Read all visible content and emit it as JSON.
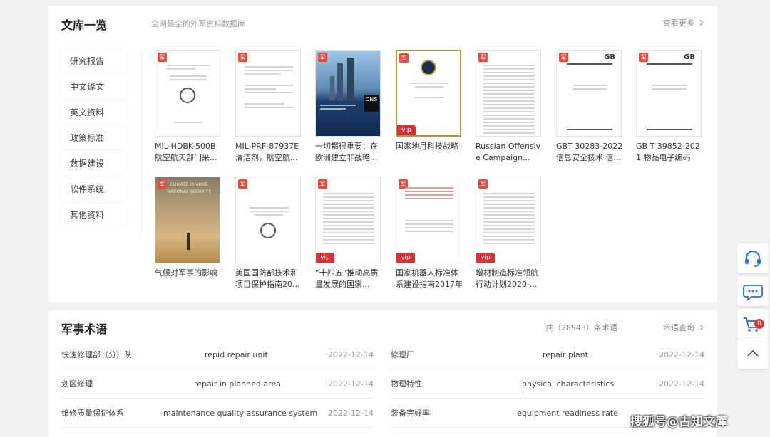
{
  "library": {
    "title": "文库一览",
    "subtitle": "全网最全的外军资料数据库",
    "more": "查看更多",
    "categories": [
      "研究报告",
      "中文译文",
      "英文资料",
      "政策标准",
      "数据建设",
      "软件系统",
      "其他资料"
    ],
    "docs": [
      {
        "title": "MIL-HDBK-500B 航空航天部门采...",
        "vip": false
      },
      {
        "title": "MIL-PRF-87937E 清洁剂，航空航...",
        "vip": false
      },
      {
        "title": "一切都很重要：在欧洲建立非战略...",
        "vip": false
      },
      {
        "title": "国家地月科技战略",
        "vip": true
      },
      {
        "title": "Russian Offensive Campaign...",
        "vip": false
      },
      {
        "title": "GBT 30283-2022 信息安全技术 信...",
        "vip": false
      },
      {
        "title": "GB T 39852-2021 物品电子编码 标...",
        "vip": false
      },
      {
        "title": "气候对军事的影响",
        "vip": false
      },
      {
        "title": "美国国防部技术和项目保护指南20...",
        "vip": false
      },
      {
        "title": "“十四五”推动高质量发展的国家...",
        "vip": true
      },
      {
        "title": "国家机器人标准体系建设指南2017年",
        "vip": true
      },
      {
        "title": "增材制造标准领航行动计划2020-...",
        "vip": true
      }
    ],
    "mark_glyph": "军",
    "vip_label": "vip",
    "cover_texts": {
      "cns": "CNS",
      "climate_line1": "CLIMATE CHANGE",
      "climate_line2": "NATIONAL SECURITY",
      "gb": "GB"
    }
  },
  "terms": {
    "title": "军事术语",
    "count_text": "共（28943）条术语",
    "more": "术语查询",
    "rows": [
      {
        "cn": "快速修理部（分）队",
        "en": "repid repair unit",
        "date": "2022-12-14"
      },
      {
        "cn": "修理厂",
        "en": "repair plant",
        "date": "2022-12-14"
      },
      {
        "cn": "划区修理",
        "en": "repair in planned area",
        "date": "2022-12-14"
      },
      {
        "cn": "物理特性",
        "en": "physical characteristics",
        "date": "2022-12-14"
      },
      {
        "cn": "维修质量保证体系",
        "en": "maintenance quality assurance system",
        "date": "2022-12-14"
      },
      {
        "cn": "装备完好率",
        "en": "equipment readiness rate",
        "date": ""
      }
    ]
  },
  "sidebar": {
    "cart_count": "0"
  },
  "watermark": "搜狐号@古知文库",
  "colors": {
    "accent": "#e84a3c",
    "vip": "#d9303a",
    "badge": "#e53935"
  }
}
